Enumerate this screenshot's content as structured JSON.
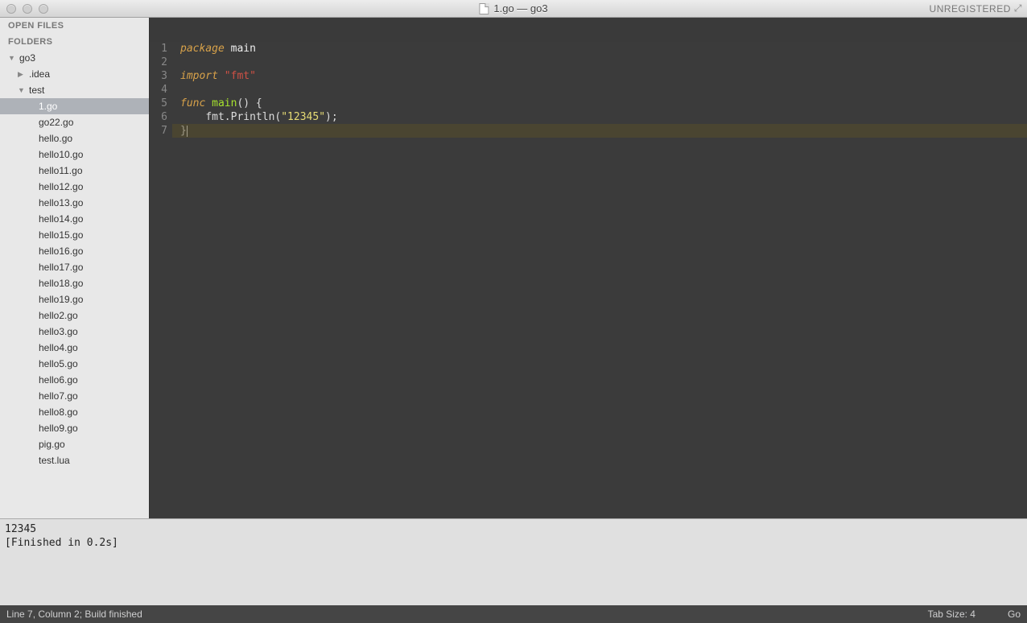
{
  "titlebar": {
    "title": "1.go — go3",
    "unregistered": "UNREGISTERED"
  },
  "sidebar": {
    "open_files_label": "OPEN FILES",
    "folders_label": "FOLDERS",
    "root": {
      "name": "go3",
      "expanded": true
    },
    "children": [
      {
        "name": ".idea",
        "type": "folder",
        "expanded": false
      },
      {
        "name": "test",
        "type": "folder",
        "expanded": true,
        "children": [
          {
            "name": "1.go",
            "selected": true
          },
          {
            "name": "go22.go"
          },
          {
            "name": "hello.go"
          },
          {
            "name": "hello10.go"
          },
          {
            "name": "hello11.go"
          },
          {
            "name": "hello12.go"
          },
          {
            "name": "hello13.go"
          },
          {
            "name": "hello14.go"
          },
          {
            "name": "hello15.go"
          },
          {
            "name": "hello16.go"
          },
          {
            "name": "hello17.go"
          },
          {
            "name": "hello18.go"
          },
          {
            "name": "hello19.go"
          },
          {
            "name": "hello2.go"
          },
          {
            "name": "hello3.go"
          },
          {
            "name": "hello4.go"
          },
          {
            "name": "hello5.go"
          },
          {
            "name": "hello6.go"
          },
          {
            "name": "hello7.go"
          },
          {
            "name": "hello8.go"
          },
          {
            "name": "hello9.go"
          },
          {
            "name": "pig.go"
          },
          {
            "name": "test.lua"
          }
        ]
      }
    ]
  },
  "editor": {
    "line_numbers": [
      "1",
      "2",
      "3",
      "4",
      "5",
      "6",
      "7"
    ],
    "code": {
      "l1": {
        "kw": "package",
        "pkg": " main"
      },
      "l3": {
        "kw": "import",
        "str": "\"fmt\""
      },
      "l5": {
        "kw": "func",
        "fn": " main",
        "rest": "() {"
      },
      "l6": {
        "indent": "    ",
        "call": "fmt.Println(",
        "str": "\"12345\"",
        "end": ");"
      },
      "l7": {
        "close": "}"
      }
    },
    "highlight_line_index": 6
  },
  "output": {
    "line1": "12345",
    "line2": "[Finished in 0.2s]"
  },
  "statusbar": {
    "left": "Line 7, Column 2; Build finished",
    "tab_size": "Tab Size: 4",
    "syntax": "Go"
  }
}
